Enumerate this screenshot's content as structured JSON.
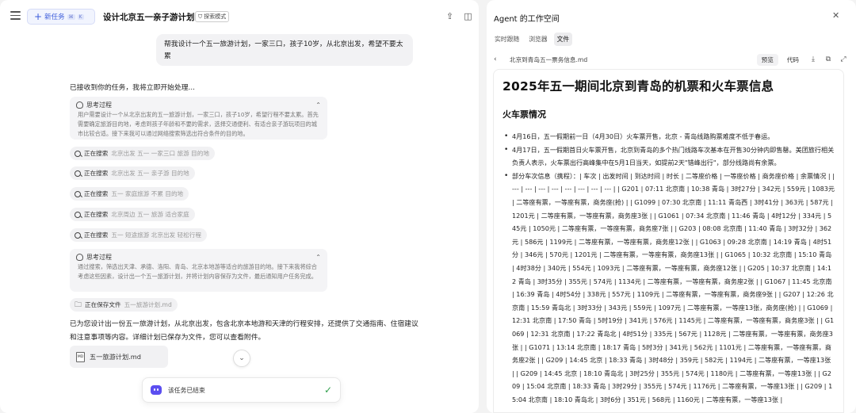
{
  "header": {
    "new_task_label": "新任务",
    "new_task_kbd1": "⌘",
    "new_task_kbd2": "K",
    "task_title": "设计北京五一亲子游计划",
    "mode_badge": "探索模式"
  },
  "conversation": {
    "user_message": "帮我设计一个五一旅游计划，一家三口，孩子10岁，从北京出发，希望不要太累",
    "ack": "已接收到你的任务，我将立即开始处理...",
    "thinking_label": "思考过程",
    "thinking_1": "用户需要设计一个从北京出发的五一旅游计划，一家三口，孩子10岁，希望行程不要太累。首先需要确定旅游目的地，考虑到孩子年龄和不要的需求，选择交通便利、有适合亲子游玩项目的城市比较合适。接下来我可以通过网络搜索筛选出符合条件的目的地。",
    "searching_label": "正在搜索",
    "searches": [
      "北京出发 五一 一家三口 旅游 目的地",
      "北京出发 五一 亲子游 目的地",
      "五一 家庭旅游 不累 目的地",
      "北京周边 五一 旅游 适合家庭",
      "五一 短途旅游 北京出发 轻松行程"
    ],
    "thinking_2": "通过搜索，筛选出天津、承德、洛阳、青岛、北京本地游等适合的旅游目的地。接下来我将综合考虑这些因素，设计出一个五一旅游计划，并将计划内容保存为文件，最后通知用户任务完成。",
    "saving_label": "正在保存文件",
    "saving_file": "五一旅游计划.md",
    "summary": "已为您设计出一份五一旅游计划，从北京出发，包含北京本地游和天津的行程安排，还提供了交通指南、住宿建议和注意事项等内容。详细计划已保存为文件，您可以查看附件。",
    "attachment": "五一旅游计划.md",
    "attachment_icon_text": "MD",
    "done_text": "该任务已结束"
  },
  "workspace": {
    "title": "Agent 的工作空间",
    "tabs": [
      "实时跟随",
      "浏览器",
      "文件"
    ],
    "file_name": "北京到青岛五一票务信息.md",
    "preview_label": "预览",
    "code_label": "代码",
    "doc": {
      "title": "2025年五一期间北京到青岛的机票和火车票信息",
      "section": "火车票情况",
      "bullets": [
        "4月16日，五一假期前一日（4月30日）火车票开售，北京 - 青岛线路购票难度不低于春运。",
        "4月17日，五一假期首日火车票开售，北京到青岛的多个热门线路车次基本在开售30分钟内即售罄。美团旅行相关负责人表示，火车票出行高峰集中在5月1日当天，如提前2天\"错峰出行\"，部分线路尚有余票。",
        "部分车次信息（携程）：| 车次 | 出发时间 | 到达时间 | 时长 | 二等座价格 | 一等座价格 | 商务座价格 | 余票情况 | | --- | --- | --- | --- | --- | --- | --- | --- | | G201 | 07:11 北京南 | 10:38 青岛 | 3时27分 | 342元 | 559元 | 1083元 | 二等座有票，一等座有票，商务座(抢) | | G1099 | 07:30 北京南 | 11:11 青岛西 | 3时41分 | 363元 | 587元 | 1201元 | 二等座有票，一等座有票，商务座3张 | | G1061 | 07:34 北京南 | 11:46 青岛 | 4时12分 | 334元 | 545元 | 1050元 | 二等座有票，一等座有票，商务座7张 | | G203 | 08:08 北京南 | 11:40 青岛 | 3时32分 | 362元 | 586元 | 1199元 | 二等座有票，一等座有票，商务座12张 | | G1063 | 09:28 北京南 | 14:19 青岛 | 4时51分 | 346元 | 570元 | 1201元 | 二等座有票，一等座有票，商务座13张 | | G1065 | 10:32 北京南 | 15:10 青岛 | 4时38分 | 340元 | 554元 | 1093元 | 二等座有票，一等座有票，商务座12张 | | G205 | 10:37 北京南 | 14:12 青岛 | 3时35分 | 355元 | 574元 | 1134元 | 二等座有票，一等座有票，商务座2张 | | G1067 | 11:45 北京南 | 16:39 青岛 | 4时54分 | 338元 | 557元 | 1109元 | 二等座有票，一等座有票，商务座9张 | | G207 | 12:26 北京南 | 15:59 青岛北 | 3时33分 | 343元 | 559元 | 1097元 | 二等座有票，一等座13张，商务座(抢) | | G1069 | 12:31 北京南 | 17:50 青岛 | 5时19分 | 341元 | 576元 | 1145元 | 二等座有票，一等座有票，商务座3张 | | G1069 | 12:31 北京南 | 17:22 青岛北 | 4时51分 | 335元 | 567元 | 1128元 | 二等座有票，一等座有票，商务座3张 | | G1071 | 13:14 北京南 | 18:17 青岛 | 5时3分 | 341元 | 562元 | 1101元 | 二等座有票，一等座有票，商务座2张 | | G209 | 14:45 北京 | 18:33 青岛 | 3时48分 | 359元 | 582元 | 1194元 | 二等座有票，一等座13张 | | G209 | 14:45 北京 | 18:10 青岛北 | 3时25分 | 355元 | 574元 | 1180元 | 二等座有票，一等座13张 | | G209 | 15:04 北京南 | 18:33 青岛 | 3时29分 | 355元 | 574元 | 1176元 | 二等座有票，一等座13张 | | G209 | 15:04 北京南 | 18:10 青岛北 | 3时6分 | 351元 | 568元 | 1160元 | 二等座有票，一等座13张 |"
      ]
    }
  }
}
